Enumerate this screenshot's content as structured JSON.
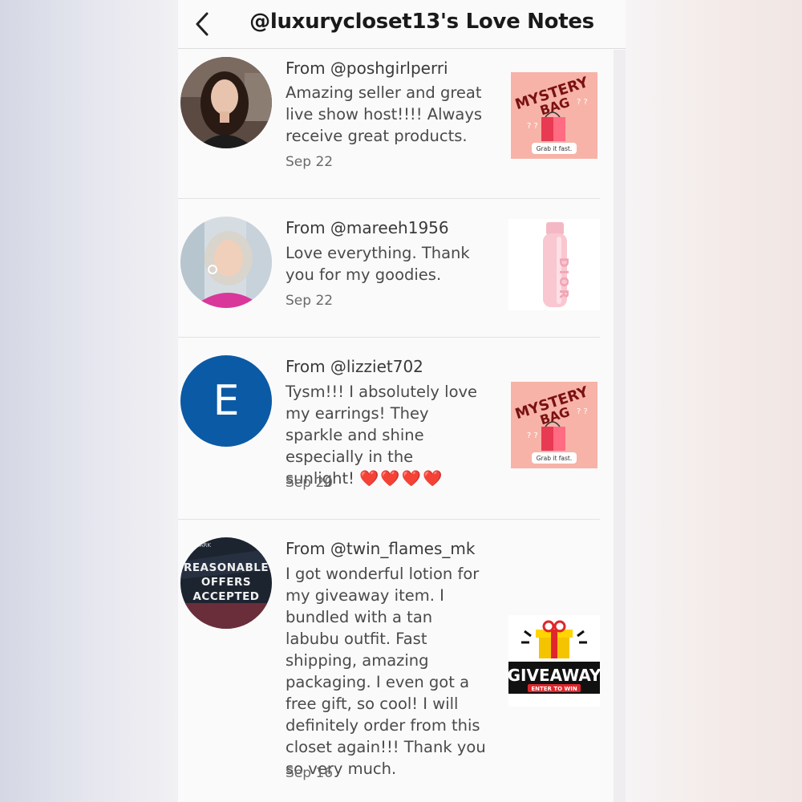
{
  "header": {
    "title": "@luxurycloset13's Love Notes"
  },
  "notes": [
    {
      "from": "From @poshgirlperri",
      "message": "Amazing seller and great live show host!!!! Always receive great products.",
      "date": "Sep 22",
      "thumbnail": "mystery-bag"
    },
    {
      "from": "From @mareeh1956",
      "message": "Love everything. Thank you for my goodies.",
      "date": "Sep 22",
      "thumbnail": "dior-bottle"
    },
    {
      "from": "From @lizziet702",
      "message": "Tysm!!! I absolutely love my earrings! They sparkle and shine especially in the sunlight!",
      "emoji": "❤️❤️❤️❤️",
      "date": "Sep 20",
      "avatar_letter": "E",
      "thumbnail": "mystery-bag"
    },
    {
      "from": "From @twin_flames_mk",
      "message": "I got wonderful lotion for my giveaway item. I bundled with a tan labubu outfit. Fast shipping, amazing packaging. I even got a free gift, so cool! I will definitely order from this closet again!!! Thank you so very much.",
      "date": "Sep 16",
      "thumbnail": "giveaway"
    }
  ],
  "mystery_bag": {
    "line1": "MYSTERY",
    "line2": "BAG",
    "caption": "Grab it fast."
  },
  "dior": {
    "text": "DIOR"
  },
  "reasonable": {
    "top": "SHMARK",
    "line1": "REASONABLE",
    "line2": "OFFERS",
    "line3": "ACCEPTED"
  },
  "giveaway": {
    "title": "GIVEAWAY",
    "sub": "ENTER TO WIN"
  },
  "colors": {
    "avatar_blue": "#0b5aa5",
    "mystery_bg": "#f7b3a8",
    "heart": "#e0242f"
  }
}
